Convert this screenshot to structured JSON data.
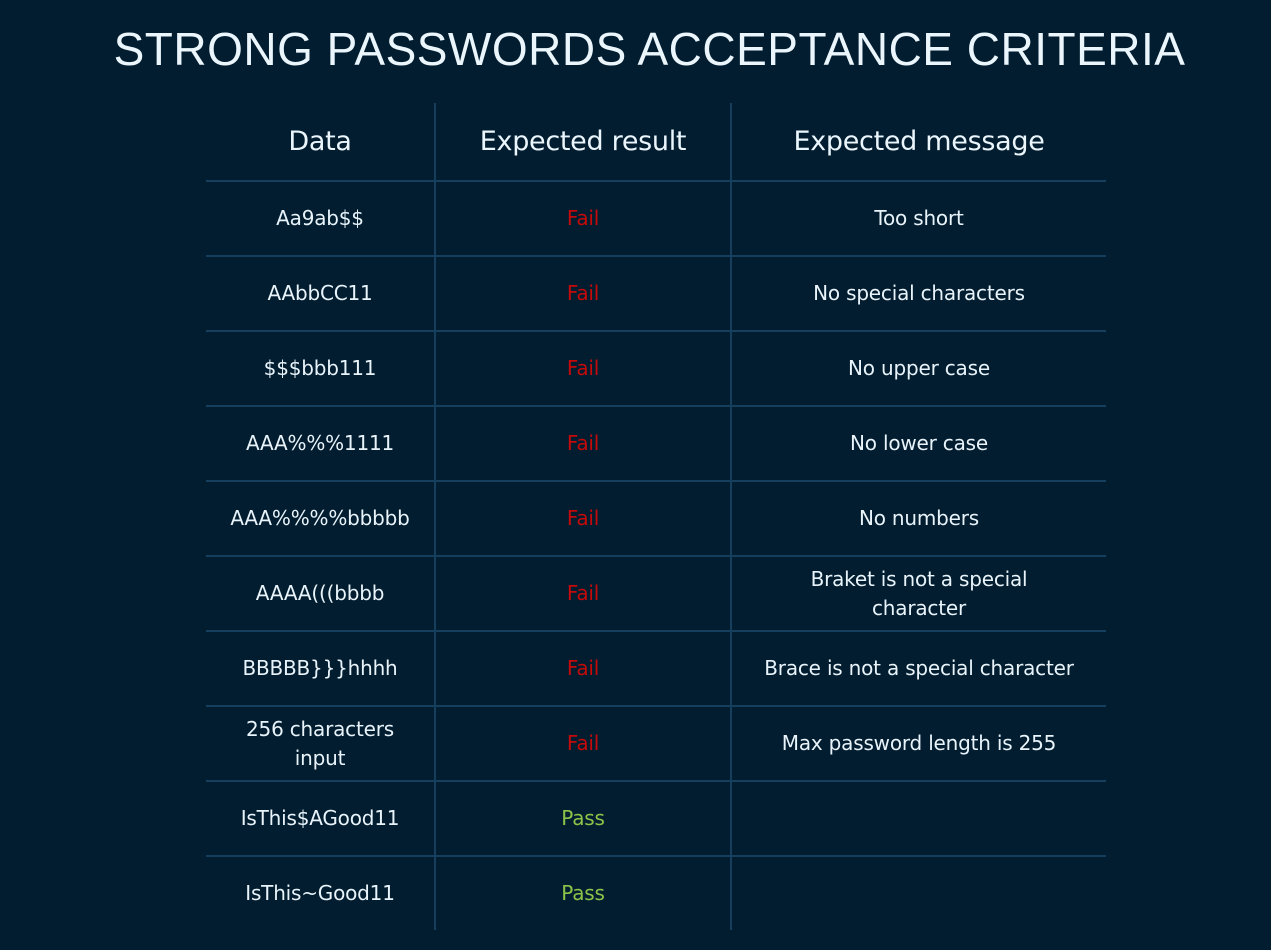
{
  "title": "STRONG PASSWORDS ACCEPTANCE CRITERIA",
  "colors": {
    "background": "#021d2f",
    "grid": "#163f5e",
    "text": "#e8f3fa",
    "fail": "#c40a0a",
    "pass": "#8cc44a"
  },
  "table": {
    "headers": [
      "Data",
      "Expected result",
      "Expected message"
    ],
    "rows": [
      {
        "data": "Aa9ab$$",
        "result": "Fail",
        "message": "Too short"
      },
      {
        "data": "AAbbCC11",
        "result": "Fail",
        "message": "No special characters"
      },
      {
        "data": "$$$bbb111",
        "result": "Fail",
        "message": "No upper case"
      },
      {
        "data": "AAA%%%1111",
        "result": "Fail",
        "message": "No lower case"
      },
      {
        "data": "AAA%%%%bbbbb",
        "result": "Fail",
        "message": "No numbers"
      },
      {
        "data": "AAAA(((bbbb",
        "result": "Fail",
        "message": "Braket is not a special character"
      },
      {
        "data": "BBBBB}}}hhhh",
        "result": "Fail",
        "message": "Brace is not a special character"
      },
      {
        "data": "256 characters input",
        "result": "Fail",
        "message": "Max password length is 255"
      },
      {
        "data": "IsThis$AGood11",
        "result": "Pass",
        "message": ""
      },
      {
        "data": "IsThis~Good11",
        "result": "Pass",
        "message": ""
      }
    ]
  }
}
